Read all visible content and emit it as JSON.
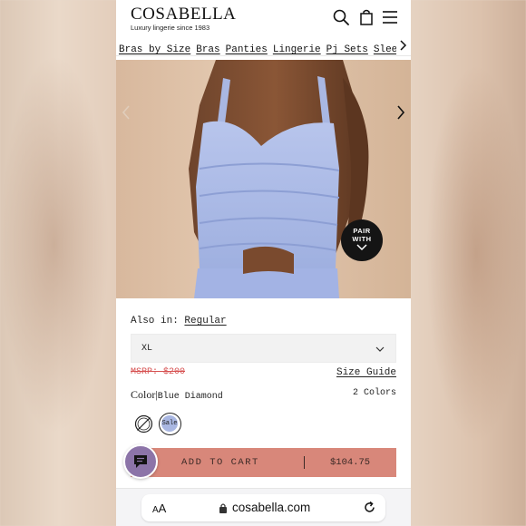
{
  "brand": {
    "name": "COSABELLA",
    "tagline": "Luxury lingerie since 1983"
  },
  "header": {
    "icons": [
      "search-icon",
      "shopping-bag-icon",
      "hamburger-menu-icon"
    ]
  },
  "nav": {
    "items": [
      "Bras by Size",
      "Bras",
      "Panties",
      "Lingerie",
      "Pj Sets",
      "Sleepw"
    ]
  },
  "hero": {
    "badge_label": "PAIR WITH"
  },
  "product": {
    "also_in_label": "Also in:",
    "also_in_link": "Regular",
    "size_selected": "XL",
    "msrp": "MSRP: $200",
    "size_guide": "Size Guide",
    "color_label": "Color",
    "color_separator": "|",
    "color_value": "Blue Diamond",
    "color_count": "2 Colors",
    "swatch_sale_label": "Sale",
    "swatch_color": "#a9b7e2"
  },
  "cart": {
    "button_label": "ADD TO CART",
    "price": "$104.75",
    "button_color": "#d8877a"
  },
  "browser": {
    "aa_small": "A",
    "aa_large": "A",
    "url": "cosabella.com"
  },
  "annotation": {
    "circle_color": "#e0362c"
  }
}
